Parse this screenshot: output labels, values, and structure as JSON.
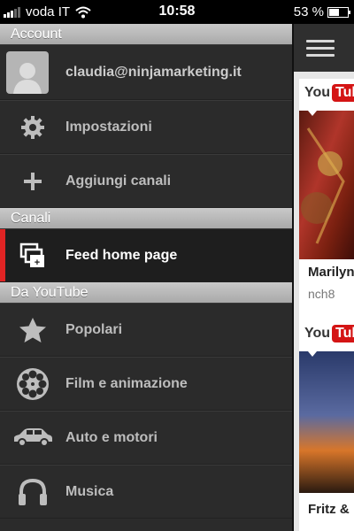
{
  "status_bar": {
    "carrier": "voda IT",
    "time": "10:58",
    "battery": "53 %",
    "battery_level": 0.53
  },
  "sidebar": {
    "sections": [
      {
        "header": "Account",
        "items": [
          {
            "label": "claudia@ninjamarketing.it",
            "icon": "avatar"
          },
          {
            "label": "Impostazioni",
            "icon": "gear-icon"
          },
          {
            "label": "Aggiungi canali",
            "icon": "plus-icon"
          }
        ]
      },
      {
        "header": "Canali",
        "items": [
          {
            "label": "Feed home page",
            "icon": "feed-icon",
            "active": true
          }
        ]
      },
      {
        "header": "Da YouTube",
        "items": [
          {
            "label": "Popolari",
            "icon": "star-icon"
          },
          {
            "label": "Film e animazione",
            "icon": "film-reel-icon"
          },
          {
            "label": "Auto e motori",
            "icon": "car-icon"
          },
          {
            "label": "Musica",
            "icon": "headphones-icon"
          }
        ]
      }
    ]
  },
  "feed": {
    "logo_you": "You",
    "logo_tube": "Tube",
    "cards": [
      {
        "title": "Marilyn",
        "subtitle": "nch8"
      },
      {
        "title": "Fritz &",
        "subtitle": ""
      }
    ]
  },
  "colors": {
    "accent": "#e02424",
    "sidebar_bg": "#2b2b2b",
    "section_header": "#b5b5b5",
    "youtube_red": "#d41414"
  }
}
